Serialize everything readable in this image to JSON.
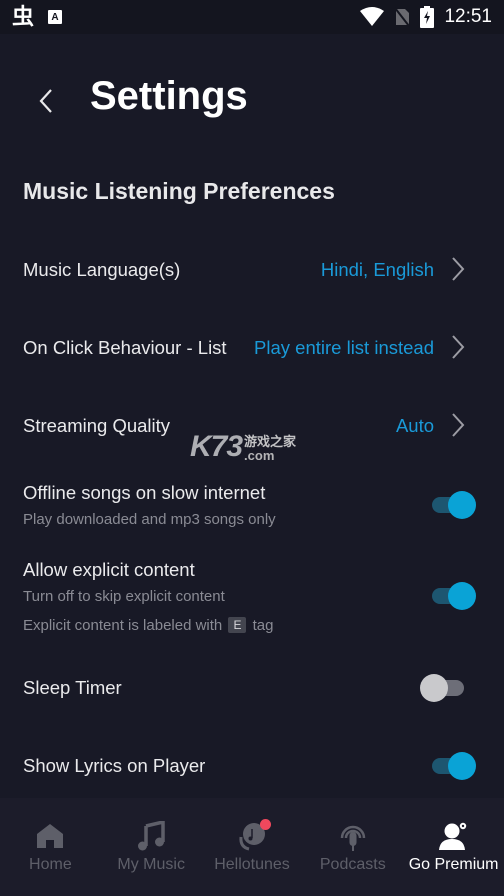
{
  "status_bar": {
    "left_icons": [
      "app-glyph-icon",
      "translate-a-icon"
    ],
    "right_icons": [
      "wifi-icon",
      "no-sim-icon",
      "battery-charging-icon"
    ],
    "time": "12:51",
    "app_glyph": "虫",
    "a_glyph": "A"
  },
  "header": {
    "title": "Settings",
    "back_icon": "chevron-left-icon"
  },
  "section": {
    "title": "Music Listening Preferences"
  },
  "settings": [
    {
      "label": "Music Language(s)",
      "value": "Hindi, English",
      "type": "link"
    },
    {
      "label": "On Click Behaviour - List",
      "value": "Play entire list instead",
      "type": "link"
    },
    {
      "label": "Streaming Quality",
      "value": "Auto",
      "type": "link"
    },
    {
      "label": "Offline songs on slow internet",
      "sub": "Play downloaded and mp3 songs only",
      "type": "toggle",
      "on": true
    },
    {
      "label": "Allow explicit content",
      "sub": "Turn off to skip explicit content",
      "sub2_before": "Explicit content is labeled with",
      "sub2_tag": "E",
      "sub2_after": "tag",
      "type": "toggle",
      "on": true
    },
    {
      "label": "Sleep Timer",
      "type": "toggle",
      "on": false
    },
    {
      "label": "Show Lyrics on Player",
      "type": "toggle",
      "on": true
    }
  ],
  "watermark": {
    "brand": "K73",
    "cn": "游戏之家",
    "domain": ".com"
  },
  "bottom_nav": [
    {
      "label": "Home",
      "icon": "home-icon",
      "active": false
    },
    {
      "label": "My Music",
      "icon": "music-note-icon",
      "active": false
    },
    {
      "label": "Hellotunes",
      "icon": "hellotunes-icon",
      "active": false,
      "badge": true
    },
    {
      "label": "Podcasts",
      "icon": "podcast-icon",
      "active": false
    },
    {
      "label": "Go Premium",
      "icon": "premium-user-icon",
      "active": true
    }
  ],
  "colors": {
    "background": "#181926",
    "accent": "#1a9ad8",
    "toggle_on": "#0aa3d6",
    "badge": "#f0485d"
  }
}
